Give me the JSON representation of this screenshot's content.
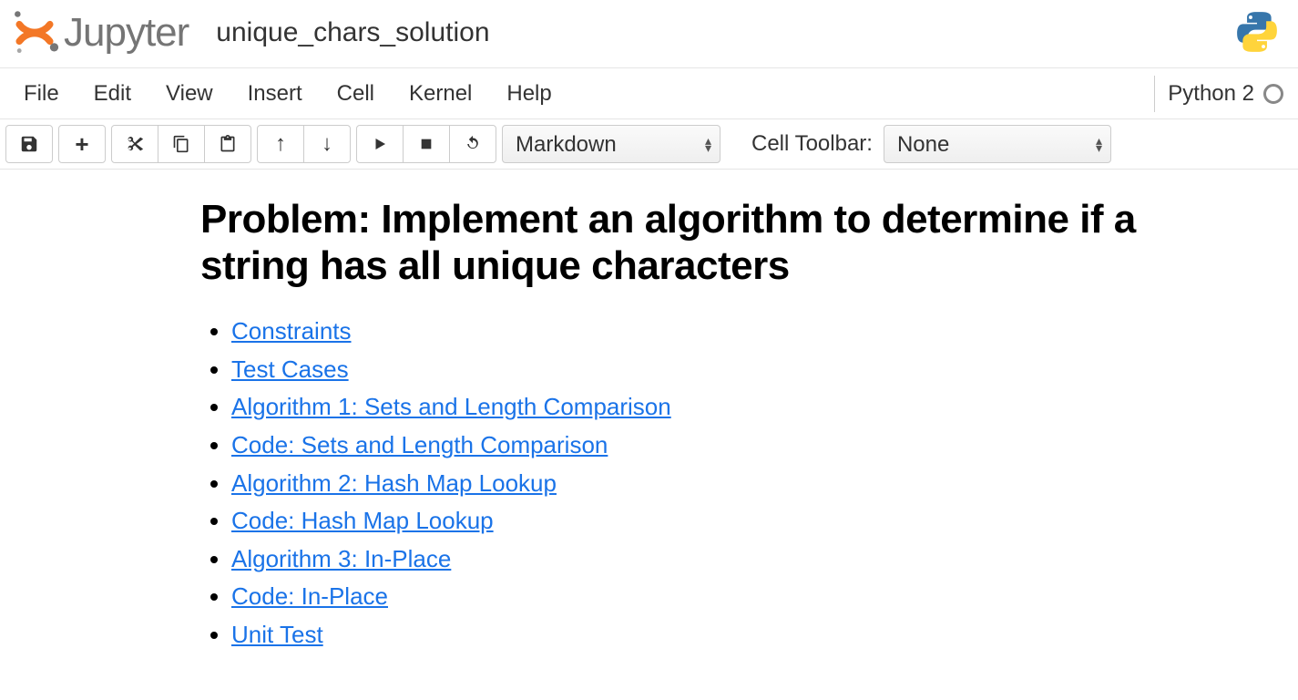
{
  "header": {
    "logo_text": "Jupyter",
    "notebook_title": "unique_chars_solution"
  },
  "menubar": {
    "items": [
      "File",
      "Edit",
      "View",
      "Insert",
      "Cell",
      "Kernel",
      "Help"
    ],
    "kernel_name": "Python 2"
  },
  "toolbar": {
    "cell_type_selected": "Markdown",
    "cell_toolbar_label": "Cell Toolbar:",
    "cell_toolbar_selected": "None"
  },
  "content": {
    "heading": "Problem: Implement an algorithm to determine if a string has all unique characters",
    "links": [
      "Constraints",
      "Test Cases",
      "Algorithm 1: Sets and Length Comparison",
      "Code: Sets and Length Comparison",
      "Algorithm 2: Hash Map Lookup",
      "Code: Hash Map Lookup",
      "Algorithm 3: In-Place",
      "Code: In-Place",
      "Unit Test"
    ]
  }
}
